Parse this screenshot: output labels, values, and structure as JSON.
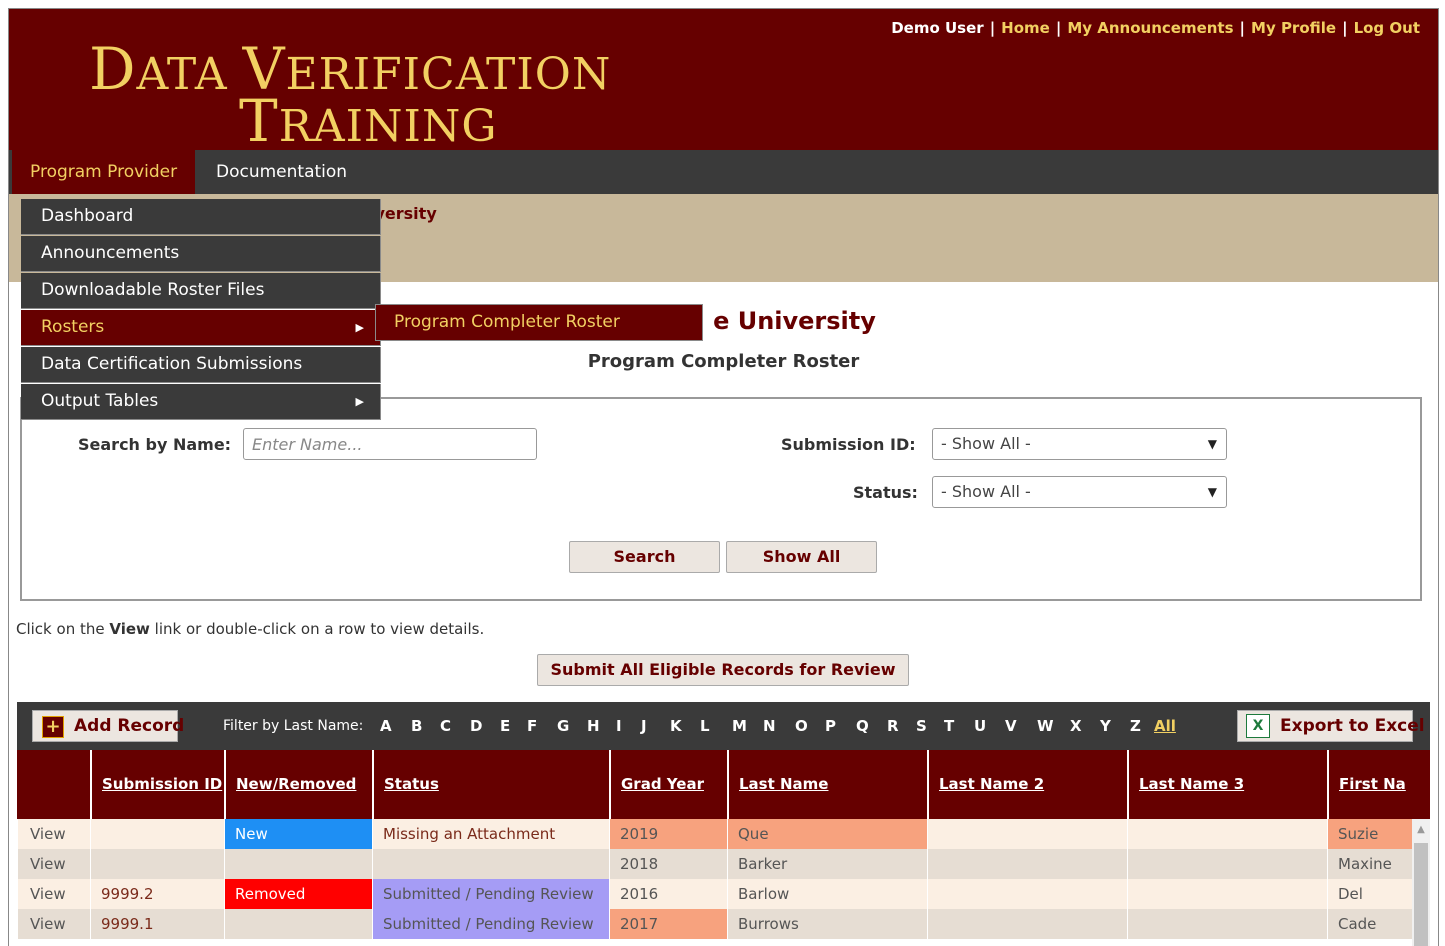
{
  "header": {
    "logo_line1_cap1": "D",
    "logo_line1_rest1": "ATA ",
    "logo_line1_cap2": "V",
    "logo_line1_rest2": "ERIFICATION",
    "logo_line2_cap": "T",
    "logo_line2_rest": "RAINING",
    "user": "Demo User",
    "links": [
      "Home",
      "My Announcements",
      "My Profile",
      "Log Out"
    ],
    "separator": "|"
  },
  "nav": {
    "items": [
      "Program Provider",
      "Documentation"
    ]
  },
  "menu": {
    "items": [
      "Dashboard",
      "Announcements",
      "Downloadable Roster Files",
      "Rosters",
      "Data Certification Submissions",
      "Output Tables"
    ],
    "submenu_item": "Program Completer Roster",
    "caret": "▶"
  },
  "banner": {
    "text_partial": "iversity"
  },
  "page": {
    "title_partial": "e University",
    "subtitle": "Program Completer Roster"
  },
  "search": {
    "name_label": "Search by Name:",
    "name_placeholder": "Enter Name...",
    "submission_label": "Submission ID:",
    "submission_value": "- Show All -",
    "status_label": "Status:",
    "status_value": "- Show All -",
    "search_button": "Search",
    "showall_button": "Show All"
  },
  "hint": {
    "pre": "Click on the ",
    "bold": "View",
    "post": " link or double-click on a row to view details."
  },
  "submit_button": "Submit All Eligible Records for Review",
  "grid": {
    "add_record": "Add Record",
    "filter_label": "Filter by Last Name:",
    "letters": [
      "A",
      "B",
      "C",
      "D",
      "E",
      "F",
      "G",
      "H",
      "I",
      "J",
      "K",
      "L",
      "M",
      "N",
      "O",
      "P",
      "Q",
      "R",
      "S",
      "T",
      "U",
      "V",
      "W",
      "X",
      "Y",
      "Z"
    ],
    "all_label": "All",
    "export": "Export to Excel",
    "columns": [
      "",
      "Submission ID",
      "New/Removed",
      "Status",
      "Grad Year",
      "Last Name",
      "Last Name 2",
      "Last Name 3",
      "First Na"
    ],
    "rows": [
      {
        "view": "View",
        "submission": "",
        "newremoved": "New",
        "status": "Missing an Attachment",
        "grad": "2019",
        "last": "Que",
        "last2": "",
        "last3": "",
        "first": "Suzie"
      },
      {
        "view": "View",
        "submission": "",
        "newremoved": "",
        "status": "",
        "grad": "2018",
        "last": "Barker",
        "last2": "",
        "last3": "",
        "first": "Maxine"
      },
      {
        "view": "View",
        "submission": "9999.2",
        "newremoved": "Removed",
        "status": "Submitted / Pending Review",
        "grad": "2016",
        "last": "Barlow",
        "last2": "",
        "last3": "",
        "first": "Del"
      },
      {
        "view": "View",
        "submission": "9999.1",
        "newremoved": "",
        "status": "Submitted / Pending Review",
        "grad": "2017",
        "last": "Burrows",
        "last2": "",
        "last3": "",
        "first": "Cade"
      }
    ]
  },
  "colors": {
    "maroon": "#660000",
    "gold": "#f2d062",
    "new": "#1e8ff4",
    "removed": "#ff0000",
    "pending": "#a59cf5",
    "salmon": "#f7a27e",
    "row_light": "#fbefe3",
    "row_dark": "#e6ddd3"
  },
  "icons": {
    "add": "plus-icon",
    "export": "excel-icon",
    "dropdown": "caret-down-icon",
    "submenu": "caret-right-icon"
  }
}
